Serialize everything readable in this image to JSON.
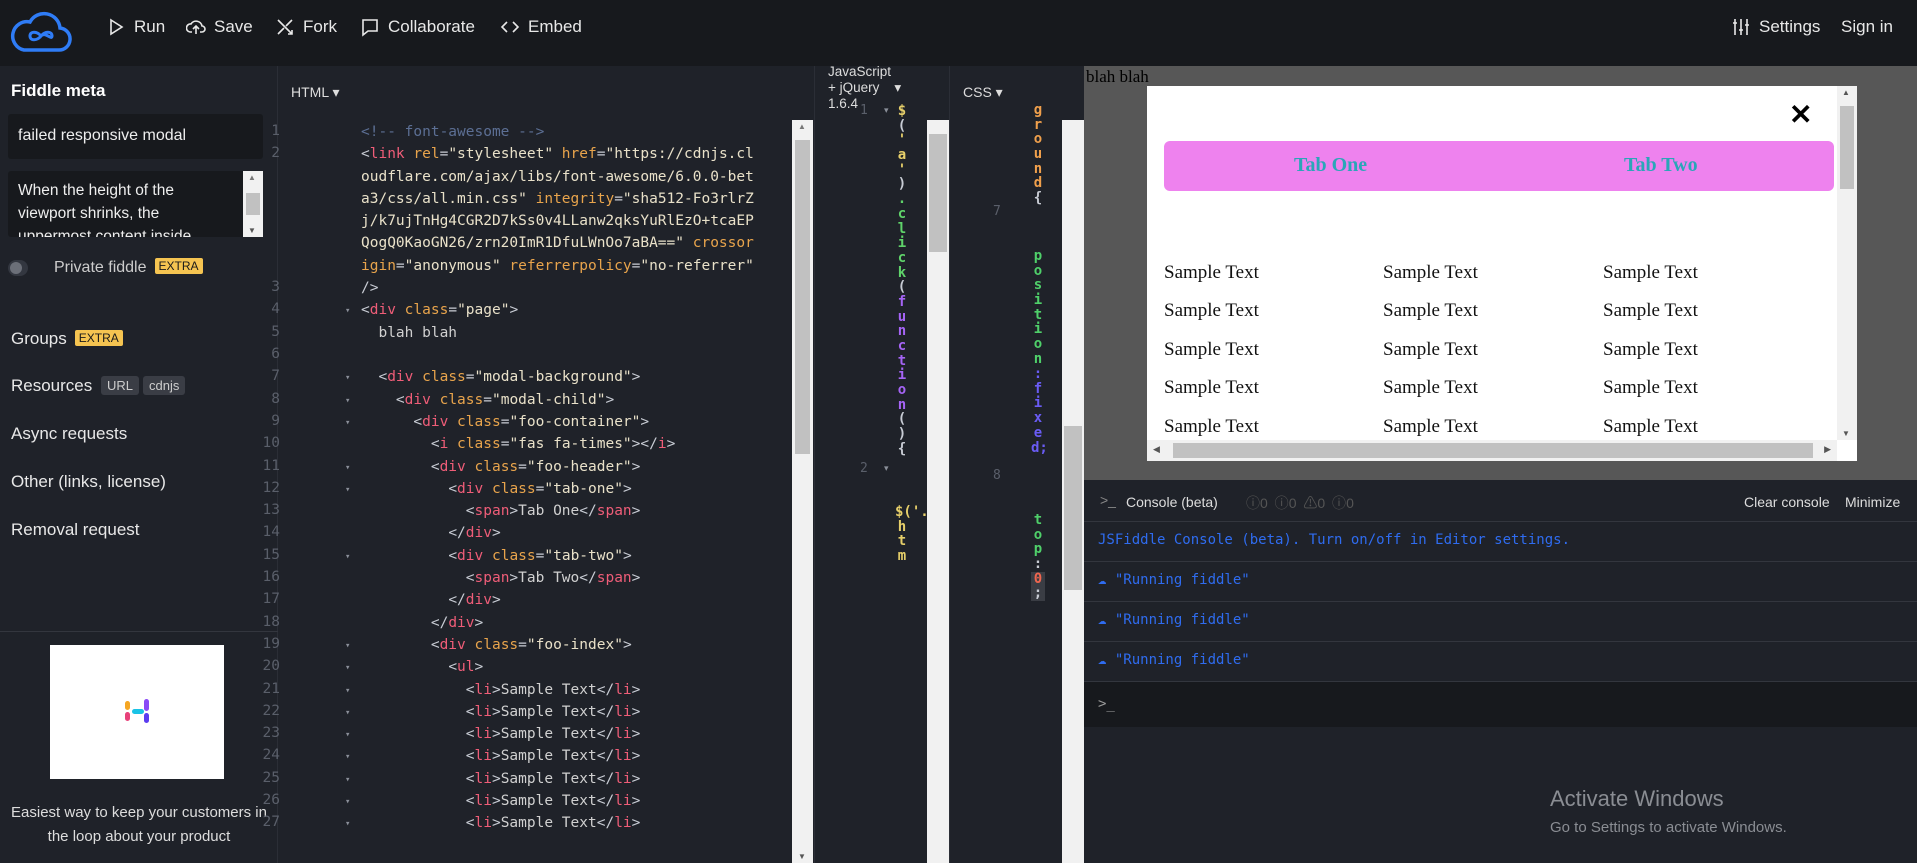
{
  "toolbar": {
    "run": "Run",
    "save": "Save",
    "fork": "Fork",
    "collaborate": "Collaborate",
    "embed": "Embed",
    "settings": "Settings",
    "sign_in": "Sign in"
  },
  "sidebar": {
    "title": "Fiddle meta",
    "name_value": "failed responsive modal",
    "description_value": "When the height of the viewport shrinks, the uppermost content inside",
    "private_label": "Private fiddle",
    "extra_badge": "EXTRA",
    "groups": "Groups",
    "resources": "Resources",
    "url_tag": "URL",
    "cdnjs_tag": "cdnjs",
    "async": "Async requests",
    "other": "Other (links, license)",
    "removal": "Removal request",
    "ad_caption": "Easiest way to keep your customers in the loop about your product",
    "accent": "#f5c451"
  },
  "html_panel": {
    "label": "HTML",
    "lines": [
      {
        "n": "1",
        "fold": false,
        "code": "<!-- font-awesome -->"
      },
      {
        "n": "2",
        "fold": false,
        "code": "<link rel=\"stylesheet\" href=\"https://cdnjs.cloudflare.com/ajax/libs/font-awesome/6.0.0-beta3/css/all.min.css\" integrity=\"sha512-Fo3rlrZj/k7ujTnHg4CGR2D7kSs0v4LLanw2qksYuRlEzO+tcaEPQogQ0KaoGN26/zrn20ImR1DfuLWnOo7aBA==\" crossorigin=\"anonymous\" referrerpolicy=\"no-referrer\" />"
      },
      {
        "n": "3",
        "fold": false,
        "code": ""
      },
      {
        "n": "4",
        "fold": true,
        "code": "<div class=\"page\">"
      },
      {
        "n": "5",
        "fold": false,
        "code": "  blah blah"
      },
      {
        "n": "6",
        "fold": false,
        "code": ""
      },
      {
        "n": "7",
        "fold": true,
        "code": "  <div class=\"modal-background\">"
      },
      {
        "n": "8",
        "fold": true,
        "code": "    <div class=\"modal-child\">"
      },
      {
        "n": "9",
        "fold": true,
        "code": "      <div class=\"foo-container\">"
      },
      {
        "n": "10",
        "fold": false,
        "code": "        <i class=\"fas fa-times\"></i>"
      },
      {
        "n": "11",
        "fold": true,
        "code": "        <div class=\"foo-header\">"
      },
      {
        "n": "12",
        "fold": true,
        "code": "          <div class=\"tab-one\">"
      },
      {
        "n": "13",
        "fold": false,
        "code": "            <span>Tab One</span>"
      },
      {
        "n": "14",
        "fold": false,
        "code": "          </div>"
      },
      {
        "n": "15",
        "fold": true,
        "code": "          <div class=\"tab-two\">"
      },
      {
        "n": "16",
        "fold": false,
        "code": "            <span>Tab Two</span>"
      },
      {
        "n": "17",
        "fold": false,
        "code": "          </div>"
      },
      {
        "n": "18",
        "fold": false,
        "code": "        </div>"
      },
      {
        "n": "19",
        "fold": true,
        "code": "        <div class=\"foo-index\">"
      },
      {
        "n": "20",
        "fold": true,
        "code": "          <ul>"
      },
      {
        "n": "21",
        "fold": true,
        "code": "            <li>Sample Text</li>"
      },
      {
        "n": "22",
        "fold": true,
        "code": "            <li>Sample Text</li>"
      },
      {
        "n": "23",
        "fold": true,
        "code": "            <li>Sample Text</li>"
      },
      {
        "n": "24",
        "fold": true,
        "code": "            <li>Sample Text</li>"
      },
      {
        "n": "25",
        "fold": true,
        "code": "            <li>Sample Text</li>"
      },
      {
        "n": "26",
        "fold": true,
        "code": "            <li>Sample Text</li>"
      },
      {
        "n": "27",
        "fold": true,
        "code": "            <li>Sample Text</li>"
      }
    ]
  },
  "js_panel": {
    "label_line1": "JavaScript",
    "label_line2": "+ jQuery",
    "label_line3": "1.6.4",
    "line1_num": "1",
    "line1": "$('a').click(function(){",
    "line2_num": "2",
    "line2": "$('.htm"
  },
  "css_panel": {
    "label": "CSS",
    "line7_num": "7",
    "line8_num": "8",
    "frag1": "ground{",
    "frag2_prop": "position",
    "frag2_val": ":fixed;",
    "frag3_prop": "top",
    "frag3_colon": ":",
    "frag3_val": "0",
    "frag3_end": ";"
  },
  "result": {
    "page_text": "blah blah",
    "close_icon": "times-icon",
    "tab_one": "Tab One",
    "tab_two": "Tab Two",
    "tab_bg": "#ee82ee",
    "tab_color": "#2aa6b8",
    "rows": [
      [
        "Sample Text",
        "Sample Text",
        "Sample Text"
      ],
      [
        "Sample Text",
        "Sample Text",
        "Sample Text"
      ],
      [
        "Sample Text",
        "Sample Text",
        "Sample Text"
      ],
      [
        "Sample Text",
        "Sample Text",
        "Sample Text"
      ],
      [
        "Sample Text",
        "Sample Text",
        "Sample Text"
      ]
    ]
  },
  "console": {
    "title": "Console (beta)",
    "counts": [
      "0",
      "0",
      "0",
      "0"
    ],
    "clear": "Clear console",
    "minimize": "Minimize",
    "intro": "JSFiddle Console (beta). Turn on/off in Editor settings.",
    "messages": [
      "\"Running fiddle\"",
      "\"Running fiddle\"",
      "\"Running fiddle\""
    ],
    "prompt": ">_"
  },
  "watermark": {
    "line1": "Activate Windows",
    "line2": "Go to Settings to activate Windows."
  }
}
